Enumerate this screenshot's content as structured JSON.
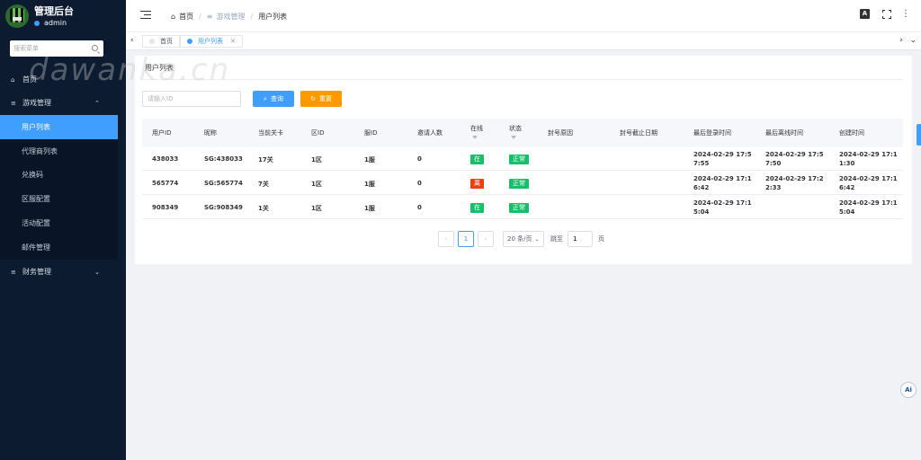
{
  "brand": {
    "title": "管理后台",
    "user": "admin"
  },
  "watermark": "dawanka.cn",
  "sidebar": {
    "search_placeholder": "搜索菜单",
    "items": [
      {
        "label": "首页",
        "icon": "home-icon"
      },
      {
        "label": "游戏管理",
        "icon": "list-icon",
        "expanded": true
      },
      {
        "label": "财务管理",
        "icon": "list-icon",
        "expanded": false
      }
    ],
    "subitems": [
      "用户列表",
      "代理商列表",
      "兑换码",
      "区服配置",
      "活动配置",
      "邮件管理"
    ]
  },
  "header": {
    "breadcrumb": [
      "首页",
      "游戏管理",
      "用户列表"
    ],
    "lang_label": "A"
  },
  "tabs": [
    {
      "label": "首页",
      "active": false
    },
    {
      "label": "用户列表",
      "active": true
    }
  ],
  "page": {
    "title": "用户列表",
    "search_placeholder": "请输入ID",
    "search_button": "查询",
    "reset_button": "重置"
  },
  "table": {
    "columns": [
      "用户ID",
      "昵称",
      "当前关卡",
      "区ID",
      "服ID",
      "邀请人数",
      "在线",
      "状态",
      "封号原因",
      "封号截止日期",
      "最后登录时间",
      "最后离线时间",
      "创建时间"
    ],
    "rows": [
      {
        "uid": "438033",
        "nick": "SG:438033",
        "level": "17关",
        "zone": "1区",
        "server": "1服",
        "invites": "0",
        "online": "在",
        "online_color": "#19be6b",
        "status": "正常",
        "ban_reason": "",
        "ban_until": "",
        "last_login": "2024-02-29 17:57:55",
        "last_offline": "2024-02-29 17:57:50",
        "created": "2024-02-29 17:11:30"
      },
      {
        "uid": "565774",
        "nick": "SG:565774",
        "level": "7关",
        "zone": "1区",
        "server": "1服",
        "invites": "0",
        "online": "离",
        "online_color": "#ed4014",
        "status": "正常",
        "ban_reason": "",
        "ban_until": "",
        "last_login": "2024-02-29 17:16:42",
        "last_offline": "2024-02-29 17:22:33",
        "created": "2024-02-29 17:16:42"
      },
      {
        "uid": "908349",
        "nick": "SG:908349",
        "level": "1关",
        "zone": "1区",
        "server": "1服",
        "invites": "0",
        "online": "在",
        "online_color": "#19be6b",
        "status": "正常",
        "ban_reason": "",
        "ban_until": "",
        "last_login": "2024-02-29 17:15:04",
        "last_offline": "",
        "created": "2024-02-29 17:15:04"
      }
    ]
  },
  "pagination": {
    "current": "1",
    "page_size": "20 条/页",
    "jump_label": "跳至",
    "jump_value": "1",
    "unit": "页"
  },
  "ai_label": "Ai",
  "colors": {
    "primary": "#409eff",
    "warning": "#ff9900",
    "success": "#19be6b",
    "danger": "#ed4014",
    "sidebar": "#0c1b30"
  }
}
